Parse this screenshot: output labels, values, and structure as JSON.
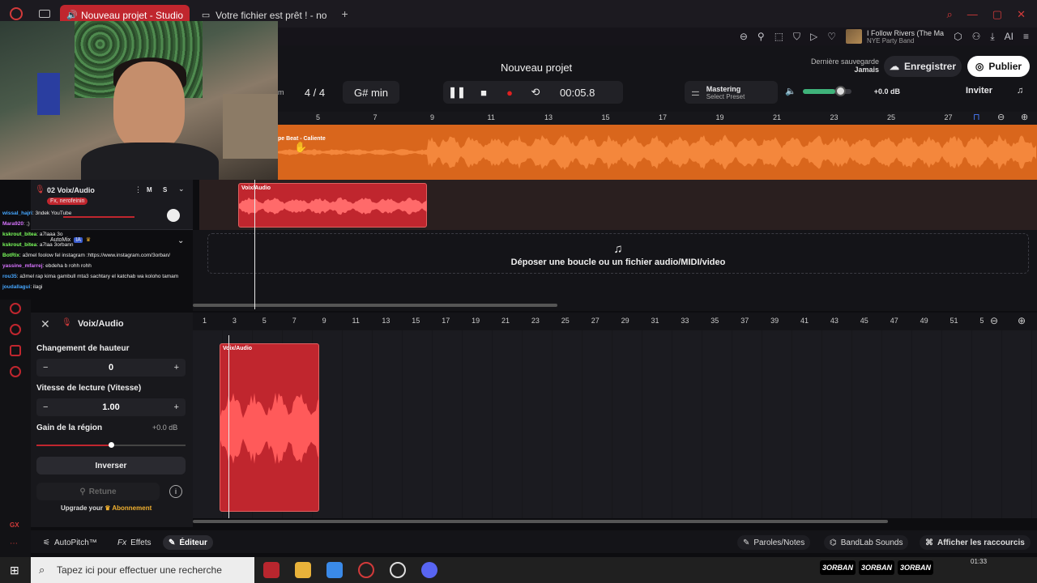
{
  "browser": {
    "tabs": [
      {
        "label": "Nouveau projet - Studio",
        "active": true
      },
      {
        "label": "Votre fichier est prêt ! - no",
        "active": false
      }
    ],
    "new_tab": "+"
  },
  "toolbar": {
    "now_playing_title": "I Follow Rivers (The Ma",
    "now_playing_sub": "NYE Party Band",
    "ai_label": "AI"
  },
  "studio": {
    "title": "Nouveau projet",
    "last_saved_label": "Dernière sauvegarde",
    "last_saved_value": "Jamais",
    "save_button": "Enregistrer",
    "publish_button": "Publier",
    "invite_button": "Inviter",
    "bpm_partial": "m",
    "time_signature": "4 / 4",
    "key": "G# min",
    "time_display": "00:05.8",
    "mastering_label": "Mastering",
    "mastering_preset": "Select Preset",
    "volume_db": "+0.0 dB",
    "colors": {
      "accent": "#c0262e",
      "beat_track": "#d9661c",
      "volume": "#3fb37a"
    }
  },
  "ruler_top": [
    "5",
    "7",
    "9",
    "11",
    "13",
    "15",
    "17",
    "19",
    "21",
    "23",
    "25",
    "27"
  ],
  "tracks": {
    "beat_region_label": "pe Beat - Caliente",
    "voice_track": {
      "name": "02  Voix/Audio",
      "mute": "M",
      "solo": "S",
      "fx_badge": "Fx, nerofeinin"
    },
    "voice_region_label": "Voix/Audio",
    "drop_zone_text": "Déposer une boucle ou un fichier audio/MIDI/video"
  },
  "chat": [
    {
      "user": "wissal_hajri",
      "msg": ": 3ndek YouTube",
      "cls": "u1"
    },
    {
      "user": "Mara920",
      "msg": ": ;)",
      "cls": "u3"
    },
    {
      "user": "kskrout_bitea",
      "msg": ": a7laaa 3o",
      "cls": "u2"
    },
    {
      "user": "kskrout_bitea",
      "msg": ": a7laa 3orbann",
      "cls": "u2"
    },
    {
      "user": "BotRix",
      "msg": ": a3mel foolow fel instagram :https://www.instagram.com/3orban/",
      "cls": "u2"
    },
    {
      "user": "yassine_mfarrej",
      "msg": ": ebdeha b rohh rohh",
      "cls": "u3"
    },
    {
      "user": "rou35",
      "msg": ": a3mel rap kima gambull mta3 sachtary el katchab wa koloho tamam",
      "cls": "u1"
    },
    {
      "user": "joudallagui",
      "msg": ": ilagi",
      "cls": "u1"
    }
  ],
  "automix": {
    "label": "AutoMix",
    "badge": "IA"
  },
  "editor": {
    "title": "Voix/Audio",
    "pitch_label": "Changement de hauteur",
    "pitch_value": "0",
    "speed_label": "Vitesse de lecture (Vitesse)",
    "speed_value": "1.00",
    "gain_label": "Gain de la région",
    "gain_value": "+0.0 dB",
    "gain_level": 0.5,
    "reverse_button": "Inverser",
    "retune_button": "Retune",
    "upgrade_prefix": "Upgrade your",
    "upgrade_link": "Abonnement",
    "region_label": "Voix/Audio",
    "ruler": [
      "1",
      "3",
      "5",
      "7",
      "9",
      "11",
      "13",
      "15",
      "17",
      "19",
      "21",
      "23",
      "25",
      "27",
      "29",
      "31",
      "33",
      "35",
      "37",
      "39",
      "41",
      "43",
      "45",
      "47",
      "49",
      "51",
      "5"
    ]
  },
  "bottom_bar": {
    "autopitch": "AutoPitch™",
    "effects": "Effets",
    "editor": "Éditeur",
    "lyrics": "Paroles/Notes",
    "sounds": "BandLab Sounds",
    "shortcuts": "Afficher les raccourcis"
  },
  "taskbar": {
    "search_placeholder": "Tapez ici pour effectuer une recherche",
    "clock": "01:33",
    "tags": [
      "3ORBAN",
      "3ORBAN",
      "3ORBAN"
    ]
  }
}
